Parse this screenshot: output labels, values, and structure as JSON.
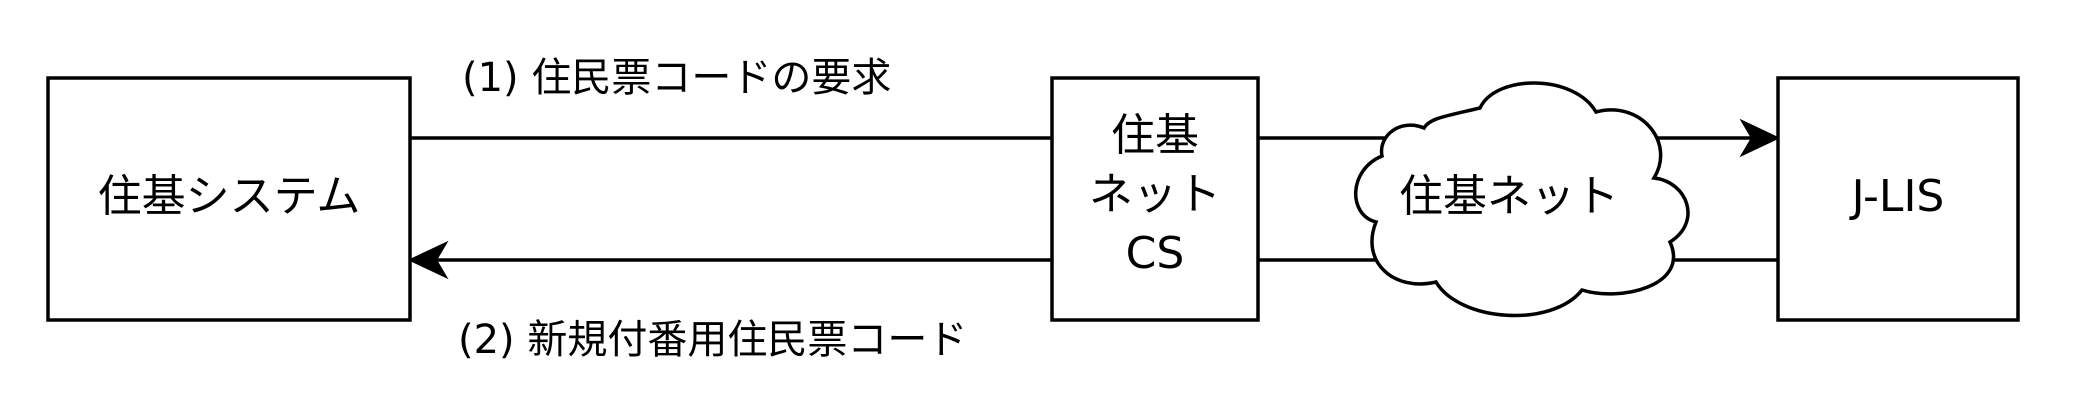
{
  "nodes": {
    "jukisystem": {
      "label": "住基システム"
    },
    "cs": {
      "lines": [
        "住基",
        "ネット",
        "CS"
      ]
    },
    "network": {
      "label": "住基ネット"
    },
    "jlis": {
      "label": "J-LIS"
    }
  },
  "edges": {
    "request": {
      "label": "(1) 住民票コードの要求"
    },
    "response": {
      "label": "(2) 新規付番用住民票コード"
    }
  }
}
